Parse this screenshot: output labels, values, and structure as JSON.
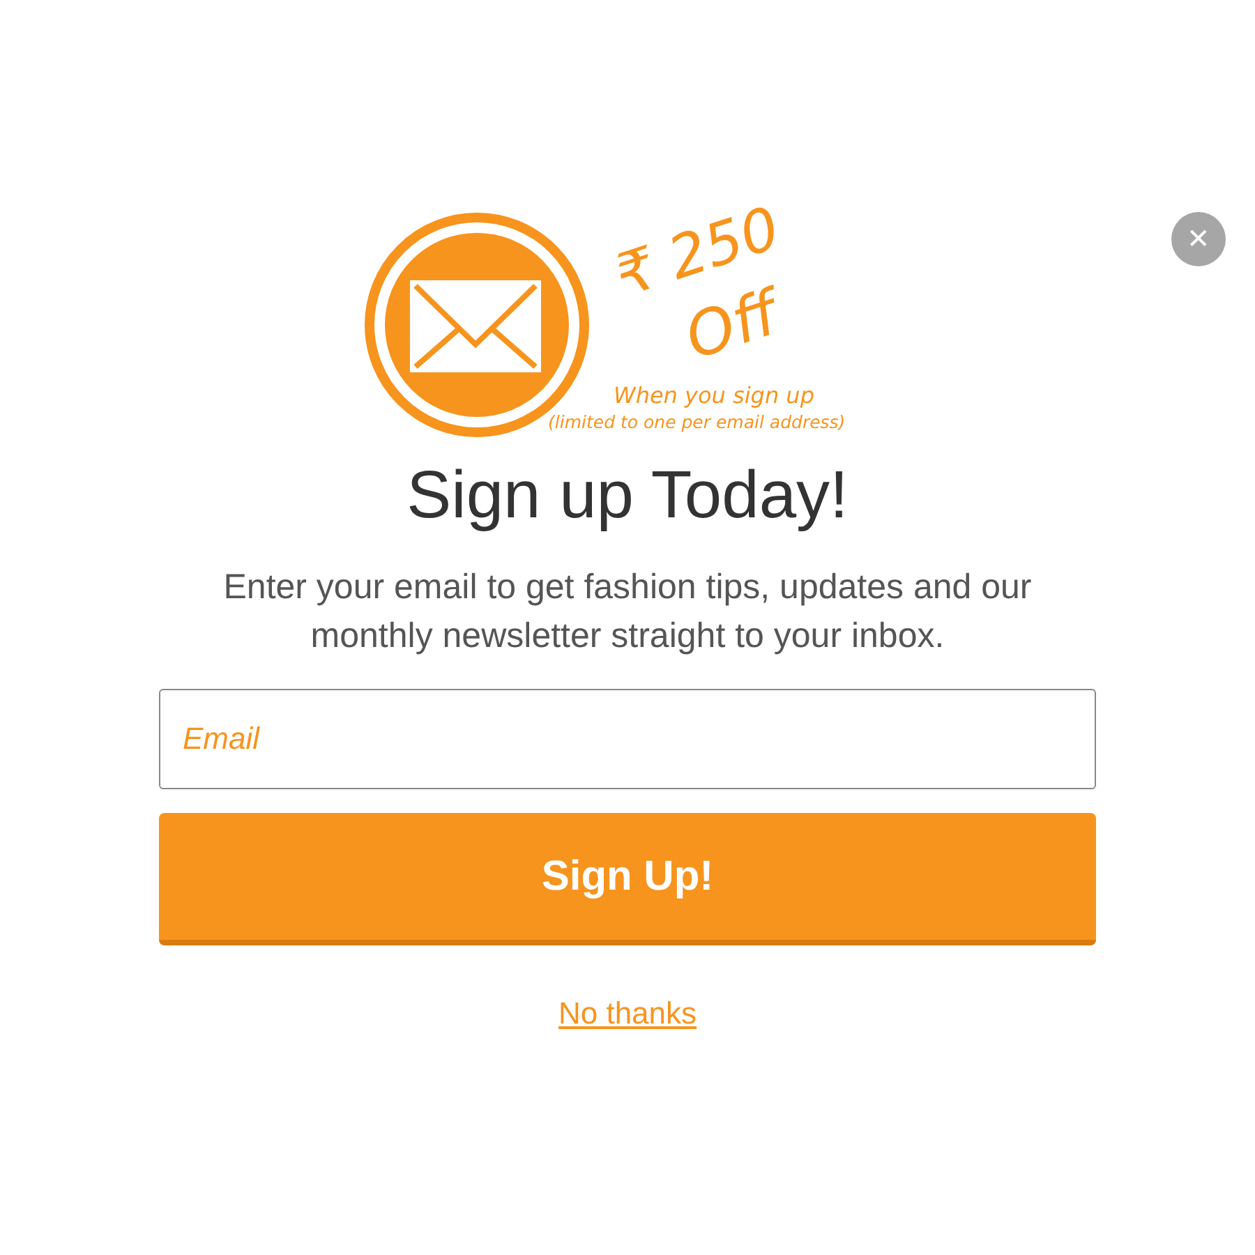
{
  "offer": {
    "amount": "₹ 250",
    "word": "Off",
    "line": "When you sign up",
    "note": "(limited to one per email address)"
  },
  "close": {
    "label": "✕"
  },
  "heading": "Sign up Today!",
  "description": "Enter your email to get fashion tips, updates and our monthly newsletter straight to your inbox.",
  "email_field": {
    "placeholder": "Email"
  },
  "submit_button": "Sign Up!",
  "decline_link": "No thanks"
}
